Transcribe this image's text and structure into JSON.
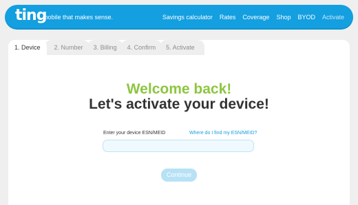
{
  "header": {
    "logo": "ting",
    "tagline": "mobile that makes sense.",
    "nav": [
      {
        "label": "Savings calculator"
      },
      {
        "label": "Rates"
      },
      {
        "label": "Coverage"
      },
      {
        "label": "Shop"
      },
      {
        "label": "BYOD"
      },
      {
        "label": "Activate"
      }
    ]
  },
  "steps": [
    {
      "label": "1. Device"
    },
    {
      "label": "2. Number"
    },
    {
      "label": "3. Billing"
    },
    {
      "label": "4. Confirm"
    },
    {
      "label": "5. Activate"
    }
  ],
  "main": {
    "welcome": "Welcome back!",
    "headline": "Let's activate your device!",
    "field_label": "Enter your device ESN/MEID",
    "help_link": "Where do I find my ESN/MEID?",
    "esn_value": "",
    "continue_label": "Continue"
  }
}
